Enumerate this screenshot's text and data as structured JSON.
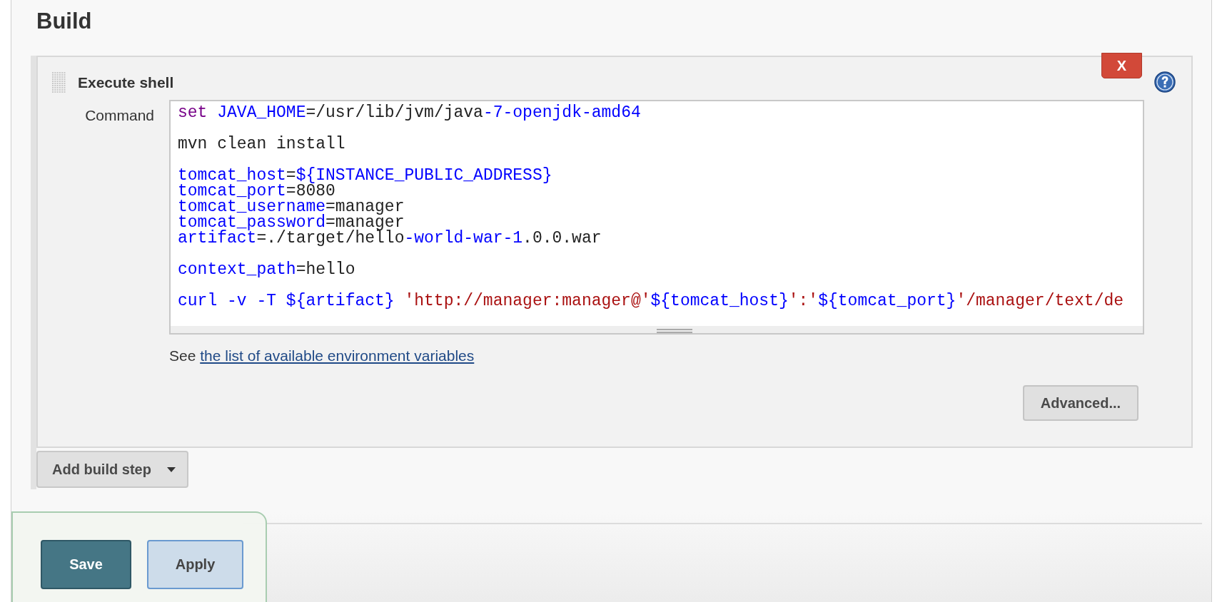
{
  "section": {
    "title": "Build"
  },
  "build_step": {
    "title": "Execute shell",
    "delete_button": "X",
    "field_label": "Command",
    "command_blocks": [
      [
        [
          {
            "text": "set",
            "kind": "keyword"
          },
          {
            "text": " JAVA_HOME",
            "kind": "variable"
          },
          {
            "text": "=/usr/lib/jvm/java",
            "kind": "plain"
          },
          {
            "text": "-7-openjdk-amd64",
            "kind": "variable"
          }
        ]
      ],
      [
        [
          {
            "text": "mvn clean install",
            "kind": "plain"
          }
        ]
      ],
      [
        [
          {
            "text": "tomcat_host",
            "kind": "variable"
          },
          {
            "text": "=",
            "kind": "plain"
          },
          {
            "text": "${INSTANCE_PUBLIC_ADDRESS}",
            "kind": "variable"
          }
        ],
        [
          {
            "text": "tomcat_port",
            "kind": "variable"
          },
          {
            "text": "=8080",
            "kind": "plain"
          }
        ],
        [
          {
            "text": "tomcat_username",
            "kind": "variable"
          },
          {
            "text": "=manager",
            "kind": "plain"
          }
        ],
        [
          {
            "text": "tomcat_password",
            "kind": "variable"
          },
          {
            "text": "=manager",
            "kind": "plain"
          }
        ],
        [
          {
            "text": "artifact",
            "kind": "variable"
          },
          {
            "text": "=./target/hello",
            "kind": "plain"
          },
          {
            "text": "-world-war-1",
            "kind": "variable"
          },
          {
            "text": ".0.0.war",
            "kind": "plain"
          }
        ]
      ],
      [
        [
          {
            "text": "context_path",
            "kind": "variable"
          },
          {
            "text": "=hello",
            "kind": "plain"
          }
        ]
      ],
      [
        [
          {
            "text": "curl -v -T ${artifact} ",
            "kind": "variable"
          },
          {
            "text": "'http://manager:manager@'",
            "kind": "string"
          },
          {
            "text": "${tomcat_host}",
            "kind": "variable"
          },
          {
            "text": "':'",
            "kind": "string"
          },
          {
            "text": "${tomcat_port}",
            "kind": "variable"
          },
          {
            "text": "'/manager/text/de",
            "kind": "string"
          }
        ]
      ]
    ],
    "hint_prefix": "See",
    "hint_link": "the list of available environment variables",
    "advanced_button": "Advanced..."
  },
  "add_step_button": "Add build step",
  "save_bar": {
    "buttons": [
      {
        "label": "Save",
        "kind": "primary"
      },
      {
        "label": "Apply",
        "kind": "secondary"
      }
    ]
  }
}
